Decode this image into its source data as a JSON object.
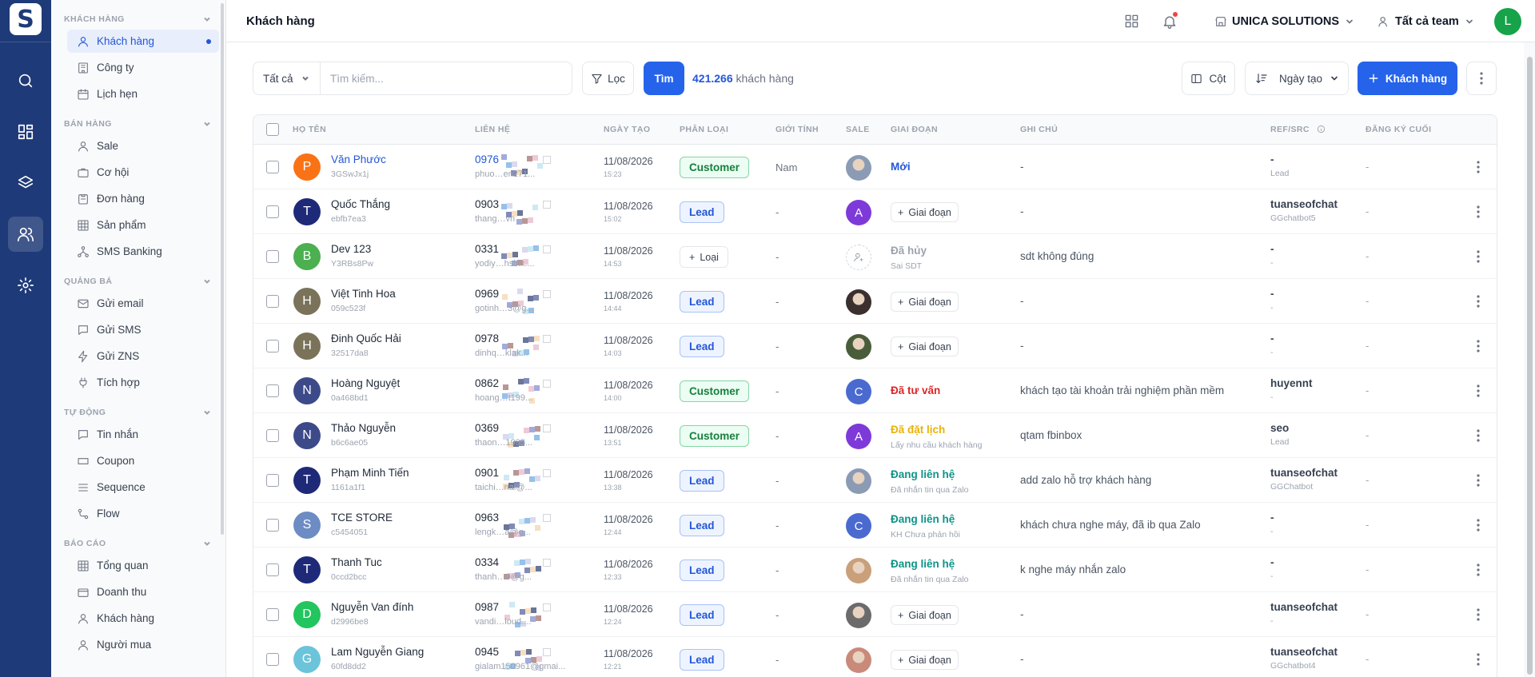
{
  "app": {
    "logo": "S"
  },
  "sidebar": {
    "sections": [
      {
        "title": "KHÁCH HÀNG",
        "items": [
          {
            "label": "Khách hàng",
            "icon": "user-icon",
            "active": true
          },
          {
            "label": "Công ty",
            "icon": "building-icon"
          },
          {
            "label": "Lịch hẹn",
            "icon": "calendar-icon"
          }
        ]
      },
      {
        "title": "BÁN HÀNG",
        "items": [
          {
            "label": "Sale",
            "icon": "user-icon"
          },
          {
            "label": "Cơ hội",
            "icon": "briefcase-icon"
          },
          {
            "label": "Đơn hàng",
            "icon": "order-icon"
          },
          {
            "label": "Sản phẩm",
            "icon": "grid-icon"
          },
          {
            "label": "SMS Banking",
            "icon": "network-icon"
          }
        ]
      },
      {
        "title": "QUẢNG BÁ",
        "items": [
          {
            "label": "Gửi email",
            "icon": "mail-icon"
          },
          {
            "label": "Gửi SMS",
            "icon": "chat-icon"
          },
          {
            "label": "Gửi ZNS",
            "icon": "bolt-icon"
          },
          {
            "label": "Tích hợp",
            "icon": "plug-icon"
          }
        ]
      },
      {
        "title": "TỰ ĐỘNG",
        "items": [
          {
            "label": "Tin nhắn",
            "icon": "chat-icon"
          },
          {
            "label": "Coupon",
            "icon": "ticket-icon"
          },
          {
            "label": "Sequence",
            "icon": "list-icon"
          },
          {
            "label": "Flow",
            "icon": "flow-icon"
          }
        ]
      },
      {
        "title": "BÁO CÁO",
        "items": [
          {
            "label": "Tổng quan",
            "icon": "grid-icon"
          },
          {
            "label": "Doanh thu",
            "icon": "wallet-icon"
          },
          {
            "label": "Khách hàng",
            "icon": "user-icon"
          },
          {
            "label": "Người mua",
            "icon": "user-icon"
          }
        ]
      }
    ]
  },
  "header": {
    "title": "Khách hàng",
    "org": "UNICA SOLUTIONS",
    "team": "Tất cả team",
    "avatar_letter": "L"
  },
  "toolbar": {
    "filter_select": "Tất cả",
    "search_placeholder": "Tìm kiếm...",
    "filter_label": "Lọc",
    "search_button": "Tìm",
    "count_value": "421.266",
    "count_label": "khách hàng",
    "columns_label": "Cột",
    "sort_label": "Ngày tạo",
    "add_label": "Khách hàng"
  },
  "table": {
    "columns": [
      "HỌ TÊN",
      "LIÊN HỆ",
      "NGÀY TẠO",
      "PHÂN LOẠI",
      "GIỚI TÍNH",
      "SALE",
      "GIAI ĐOẠN",
      "GHI CHÚ",
      "REF/SRC",
      "ĐĂNG KÝ CUỐI"
    ],
    "add_stage_label": "Giai đoạn",
    "add_type_label": "Loại",
    "rows": [
      {
        "avatar": "P",
        "avatar_color": "#f97316",
        "name": "Văn Phước",
        "name_link": true,
        "id": "3GSwJx1j",
        "phone": "0976",
        "phone_link": true,
        "email": "phuo…en271...",
        "date": "11/08/2026",
        "time": "15:23",
        "type": "Customer",
        "gender": "Nam",
        "sale": {
          "kind": "photo",
          "color": "#8b9bb4"
        },
        "stage": {
          "label": "Mới",
          "color": "#2356d8",
          "sub": ""
        },
        "note": "-",
        "ref": "-",
        "ref_sub": "Lead",
        "last": "-"
      },
      {
        "avatar": "T",
        "avatar_color": "#1e2a78",
        "name": "Quốc Thắng",
        "id": "ebfb7ea3",
        "phone": "0903",
        "email": "thang…vn",
        "date": "11/08/2026",
        "time": "15:02",
        "type": "Lead",
        "gender": "-",
        "sale": {
          "kind": "letter",
          "letter": "A",
          "color": "#7e3ad8"
        },
        "stage": null,
        "note": "-",
        "ref": "tuanseofchat",
        "ref_sub": "GGchatbot5",
        "last": "-"
      },
      {
        "avatar": "B",
        "avatar_color": "#4caf50",
        "name": "Dev 123",
        "id": "Y3RBs8Pw",
        "phone": "0331",
        "email": "yodiy…hsink....",
        "date": "11/08/2026",
        "time": "14:53",
        "type": "",
        "gender": "-",
        "sale": {
          "kind": "empty",
          "color": "#e5e7eb"
        },
        "stage": {
          "label": "Đã hủy",
          "color": "#9ca3af",
          "sub": "Sai SDT"
        },
        "note": "sdt không đúng",
        "ref": "-",
        "ref_sub": "-",
        "last": "-"
      },
      {
        "avatar": "H",
        "avatar_color": "#7a735a",
        "name": "Việt Tinh Hoa",
        "id": "059c523f",
        "phone": "0969",
        "email": "gotinh…3@g...",
        "date": "11/08/2026",
        "time": "14:44",
        "type": "Lead",
        "gender": "-",
        "sale": {
          "kind": "photo",
          "color": "#3b2f2f"
        },
        "stage": null,
        "note": "-",
        "ref": "-",
        "ref_sub": "-",
        "last": "-"
      },
      {
        "avatar": "H",
        "avatar_color": "#7a735a",
        "name": "Đinh Quốc Hải",
        "id": "32517da8",
        "phone": "0978",
        "email": "dinhq…klak...",
        "date": "11/08/2026",
        "time": "14:03",
        "type": "Lead",
        "gender": "-",
        "sale": {
          "kind": "photo",
          "color": "#4a5d3a"
        },
        "stage": null,
        "note": "-",
        "ref": "-",
        "ref_sub": "-",
        "last": "-"
      },
      {
        "avatar": "N",
        "avatar_color": "#3d4a8a",
        "name": "Hoàng Nguyệt",
        "id": "0a468bd1",
        "phone": "0862",
        "email": "hoang…t199...",
        "date": "11/08/2026",
        "time": "14:00",
        "type": "Customer",
        "gender": "-",
        "sale": {
          "kind": "letter",
          "letter": "C",
          "color": "#4a6ad0"
        },
        "stage": {
          "label": "Đã tư vấn",
          "color": "#dc2626",
          "sub": ""
        },
        "note": "khách tạo tài khoản trải nghiệm phần mềm",
        "ref": "huyennt",
        "ref_sub": "-",
        "last": "-"
      },
      {
        "avatar": "N",
        "avatar_color": "#3d4a8a",
        "name": "Thảo Nguyễn",
        "id": "b6c6ae05",
        "phone": "0369",
        "email": "thaon…1995...",
        "date": "11/08/2026",
        "time": "13:51",
        "type": "Customer",
        "gender": "-",
        "sale": {
          "kind": "letter",
          "letter": "A",
          "color": "#7e3ad8"
        },
        "stage": {
          "label": "Đã đặt lịch",
          "color": "#eab308",
          "sub": "Lấy nhu cầu khách hàng"
        },
        "note": "qtam fbinbox",
        "ref": "seo",
        "ref_sub": "Lead",
        "last": "-"
      },
      {
        "avatar": "T",
        "avatar_color": "#1e2a78",
        "name": "Phạm Minh Tiến",
        "id": "1161a1f1",
        "phone": "0901",
        "email": "taichi…nai@...",
        "date": "11/08/2026",
        "time": "13:38",
        "type": "Lead",
        "gender": "-",
        "sale": {
          "kind": "photo",
          "color": "#8b9bb4"
        },
        "stage": {
          "label": "Đang liên hệ",
          "color": "#0d9488",
          "sub": "Đã nhắn tin qua Zalo"
        },
        "note": "add zalo hỗ trợ khách hàng",
        "ref": "tuanseofchat",
        "ref_sub": "GGChatbot",
        "last": "-"
      },
      {
        "avatar": "S",
        "avatar_color": "#6d8cc4",
        "name": "TCE STORE",
        "id": "c5454051",
        "phone": "0963",
        "email": "lengk…a@g...",
        "date": "11/08/2026",
        "time": "12:44",
        "type": "Lead",
        "gender": "-",
        "sale": {
          "kind": "letter",
          "letter": "C",
          "color": "#4a6ad0"
        },
        "stage": {
          "label": "Đang liên hệ",
          "color": "#0d9488",
          "sub": "KH Chưa phản hồi"
        },
        "note": "khách chưa nghe máy, đã ib qua Zalo",
        "ref": "-",
        "ref_sub": "-",
        "last": "-"
      },
      {
        "avatar": "T",
        "avatar_color": "#1e2a78",
        "name": "Thanh Tuc",
        "id": "0ccd2bcc",
        "phone": "0334",
        "email": "thanh…9@g...",
        "date": "11/08/2026",
        "time": "12:33",
        "type": "Lead",
        "gender": "-",
        "sale": {
          "kind": "photo",
          "color": "#c9a07a"
        },
        "stage": {
          "label": "Đang liên hệ",
          "color": "#0d9488",
          "sub": "Đã nhắn tin qua Zalo"
        },
        "note": "k nghe máy nhắn zalo",
        "ref": "-",
        "ref_sub": "-",
        "last": "-"
      },
      {
        "avatar": "D",
        "avatar_color": "#22c55e",
        "name": "Nguyễn Van đính",
        "id": "d2996be8",
        "phone": "0987",
        "email": "vandi…loud....",
        "date": "11/08/2026",
        "time": "12:24",
        "type": "Lead",
        "gender": "-",
        "sale": {
          "kind": "photo",
          "color": "#6b6b6b"
        },
        "stage": null,
        "note": "-",
        "ref": "tuanseofchat",
        "ref_sub": "-",
        "last": "-"
      },
      {
        "avatar": "G",
        "avatar_color": "#6bc4d9",
        "name": "Lam Nguyễn Giang",
        "id": "60fd8dd2",
        "phone": "0945",
        "email": "gialam150961@gmai...",
        "date": "11/08/2026",
        "time": "12:21",
        "type": "Lead",
        "gender": "-",
        "sale": {
          "kind": "photo",
          "color": "#c98a7a"
        },
        "stage": null,
        "note": "-",
        "ref": "tuanseofchat",
        "ref_sub": "GGchatbot4",
        "last": "-"
      }
    ]
  }
}
